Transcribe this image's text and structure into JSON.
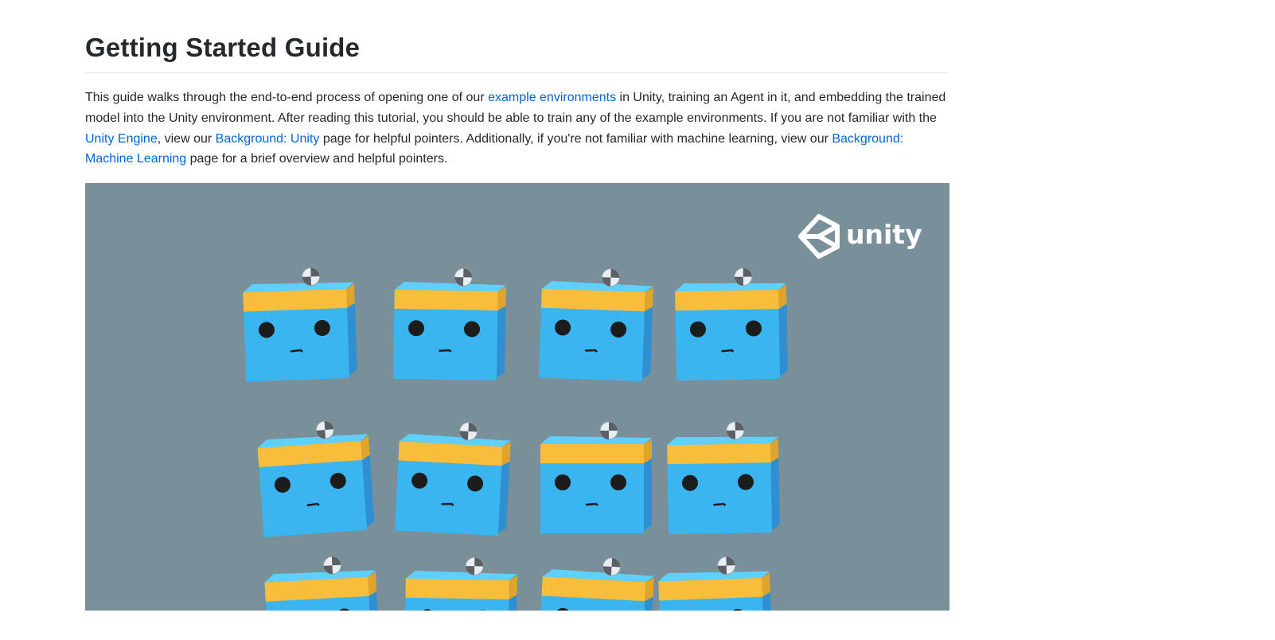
{
  "page": {
    "title": "Getting Started Guide",
    "intro": {
      "t1": "This guide walks through the end-to-end process of opening one of our ",
      "link1": "example environments",
      "t2": " in Unity, training an Agent in it, and embedding the trained model into the Unity environment. After reading this tutorial, you should be able to train any of the example environments. If you are not familiar with the ",
      "link2": "Unity Engine",
      "t3": ", view our ",
      "link3": "Background: Unity",
      "t4": " page for helpful pointers. Additionally, if you're not familiar with machine learning, view our ",
      "link4": "Background: Machine Learning",
      "t5": " page for a brief overview and helpful pointers."
    },
    "figure": {
      "logo_text": "unity",
      "logo_icon": "unity-cube-icon",
      "agents_per_row": 4,
      "rows_visible": 3
    }
  },
  "colors": {
    "link": "#0366d6",
    "figure_bg": "#79909b",
    "agent_blue": "#3ab5f0",
    "agent_band": "#f7bd3b"
  }
}
